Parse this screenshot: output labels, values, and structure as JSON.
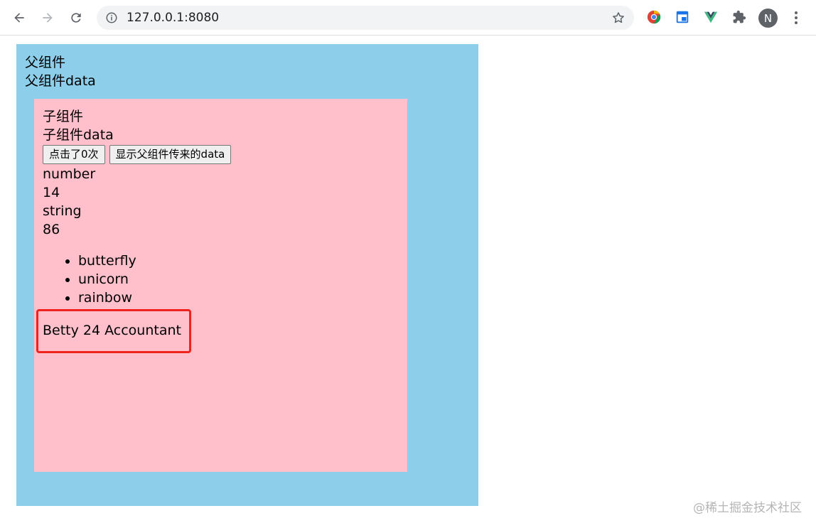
{
  "browser": {
    "url": "127.0.0.1:8080",
    "profile_initial": "N"
  },
  "parent": {
    "title": "父组件",
    "data_label": "父组件data",
    "background": "#8dceea"
  },
  "child": {
    "title": "子组件",
    "data_label": "子组件data",
    "background": "#ffc0cb",
    "buttons": {
      "click_count": "点击了0次",
      "show_parent_data": "显示父组件传来的data"
    },
    "values": [
      "number",
      "14",
      "string",
      "86"
    ],
    "list_items": [
      "butterfly",
      "unicorn",
      "rainbow"
    ],
    "person_text": "Betty 24 Accountant",
    "highlight_color": "#f0231e"
  },
  "watermark": "@稀土掘金技术社区"
}
